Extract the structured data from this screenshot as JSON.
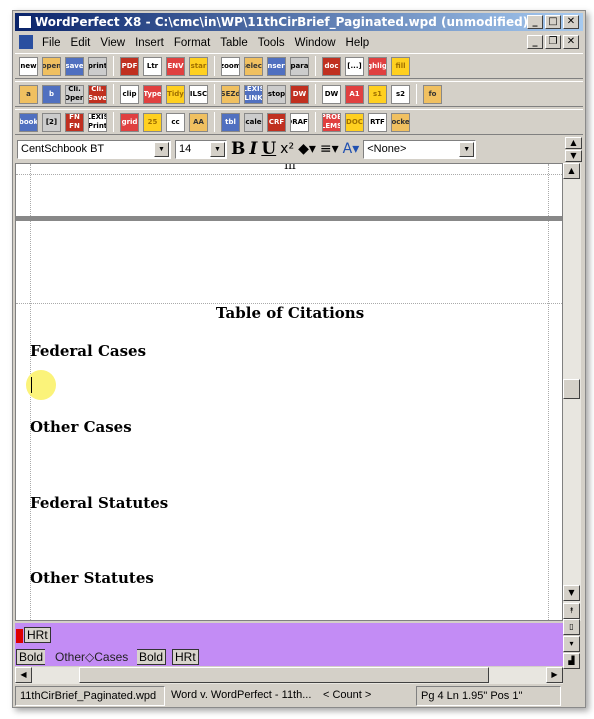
{
  "window": {
    "title": "WordPerfect X8 - C:\\cmc\\in\\WP\\11thCirBrief_Paginated.wpd (unmodified)"
  },
  "menu": [
    "File",
    "Edit",
    "View",
    "Insert",
    "Format",
    "Table",
    "Tools",
    "Window",
    "Help"
  ],
  "toolbar1": [
    "new",
    "open",
    "save",
    "print",
    "PDF",
    "Ltr",
    "ENV",
    "star",
    "zoom",
    "select",
    "insert",
    "para",
    "doc",
    "[...]",
    "highlight",
    "fill"
  ],
  "toolbar2": [
    "a",
    "b",
    "Cli. Open",
    "Cli. Save",
    "clip",
    "Type",
    "Tidy",
    "ILSC",
    "SEZd",
    "LEXIS LINK",
    "stop",
    "DW",
    "DW",
    "A1",
    "s1",
    "s2",
    "fo"
  ],
  "toolbar3": [
    "book",
    "[2]",
    "FN FN",
    "LEXIS Print",
    "grid",
    "25",
    "cc",
    "AA",
    "tbl",
    "scales",
    "CRF",
    "DRAFT",
    "PROB LEMS",
    "DOC",
    "RTF",
    "rocket"
  ],
  "property_bar": {
    "font": "CentSchbook BT",
    "size": "14",
    "bold": "B",
    "italic": "I",
    "underline": "U",
    "superscript": "x²",
    "style": "<None>"
  },
  "document": {
    "page_number": "iii",
    "heading": "Table of Citations",
    "sections": [
      "Federal Cases",
      "Other Cases",
      "Federal Statutes",
      "Other Statutes"
    ]
  },
  "reveal_codes": {
    "line1": [
      "HRt"
    ],
    "line2": [
      "Bold",
      "Other◇Cases",
      "Bold",
      "HRt"
    ]
  },
  "status": {
    "file": "11thCirBrief_Paginated.wpd",
    "doc": "Word v. WordPerfect - 11th...",
    "count": "< Count >",
    "position": "Pg 4 Ln 1.95\" Pos 1\""
  },
  "colors": {
    "title_bar": "#0a246a",
    "reveal_codes_bg": "#c38cf5"
  }
}
